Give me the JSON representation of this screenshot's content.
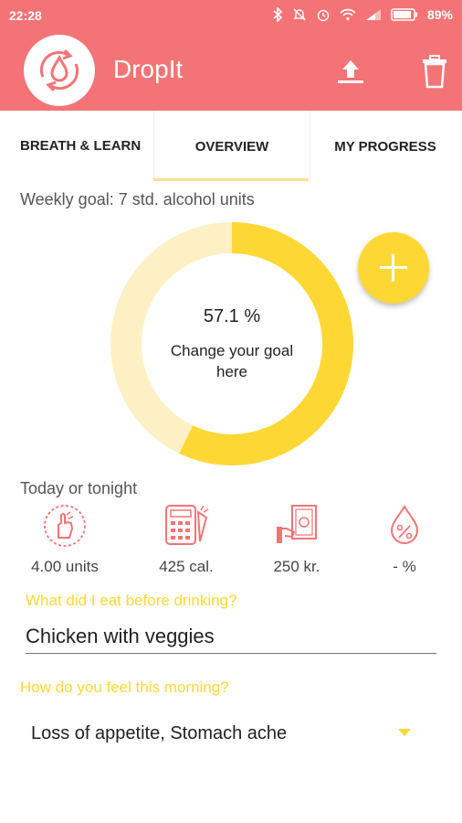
{
  "status_bar": {
    "time": "22:28",
    "battery": "89%",
    "icons": [
      "bluetooth-icon",
      "mute-icon",
      "alarm-icon",
      "wifi-icon",
      "signal-icon",
      "battery-icon"
    ]
  },
  "app_bar": {
    "title": "DropIt",
    "color": "#f47376",
    "actions": [
      "upload-icon",
      "trash-icon"
    ]
  },
  "tabs": [
    {
      "label": "BREATH & LEARN"
    },
    {
      "label": "OVERVIEW",
      "active": true
    },
    {
      "label": "MY PROGRESS"
    }
  ],
  "overview": {
    "weekly_goal": "Weekly goal: 7 std. alcohol units",
    "progress_percent": 57.1,
    "progress_label": "57.1 %",
    "change_goal": "Change your goal here",
    "accent_color": "#fdd835",
    "track_color": "#fdf0c4"
  },
  "today": {
    "title": "Today or tonight",
    "stats": [
      {
        "icon": "hand-icon",
        "value": "4.00 units"
      },
      {
        "icon": "calorie-calculator-icon",
        "value": "425 cal."
      },
      {
        "icon": "money-icon",
        "value": "250 kr."
      },
      {
        "icon": "percent-drop-icon",
        "value": "- %"
      }
    ]
  },
  "form": {
    "eat_question": "What did I eat before drinking?",
    "eat_answer": "Chicken with veggies",
    "feel_question": "How do you feel this morning?",
    "feel_answer": "Loss of appetite, Stomach ache"
  }
}
